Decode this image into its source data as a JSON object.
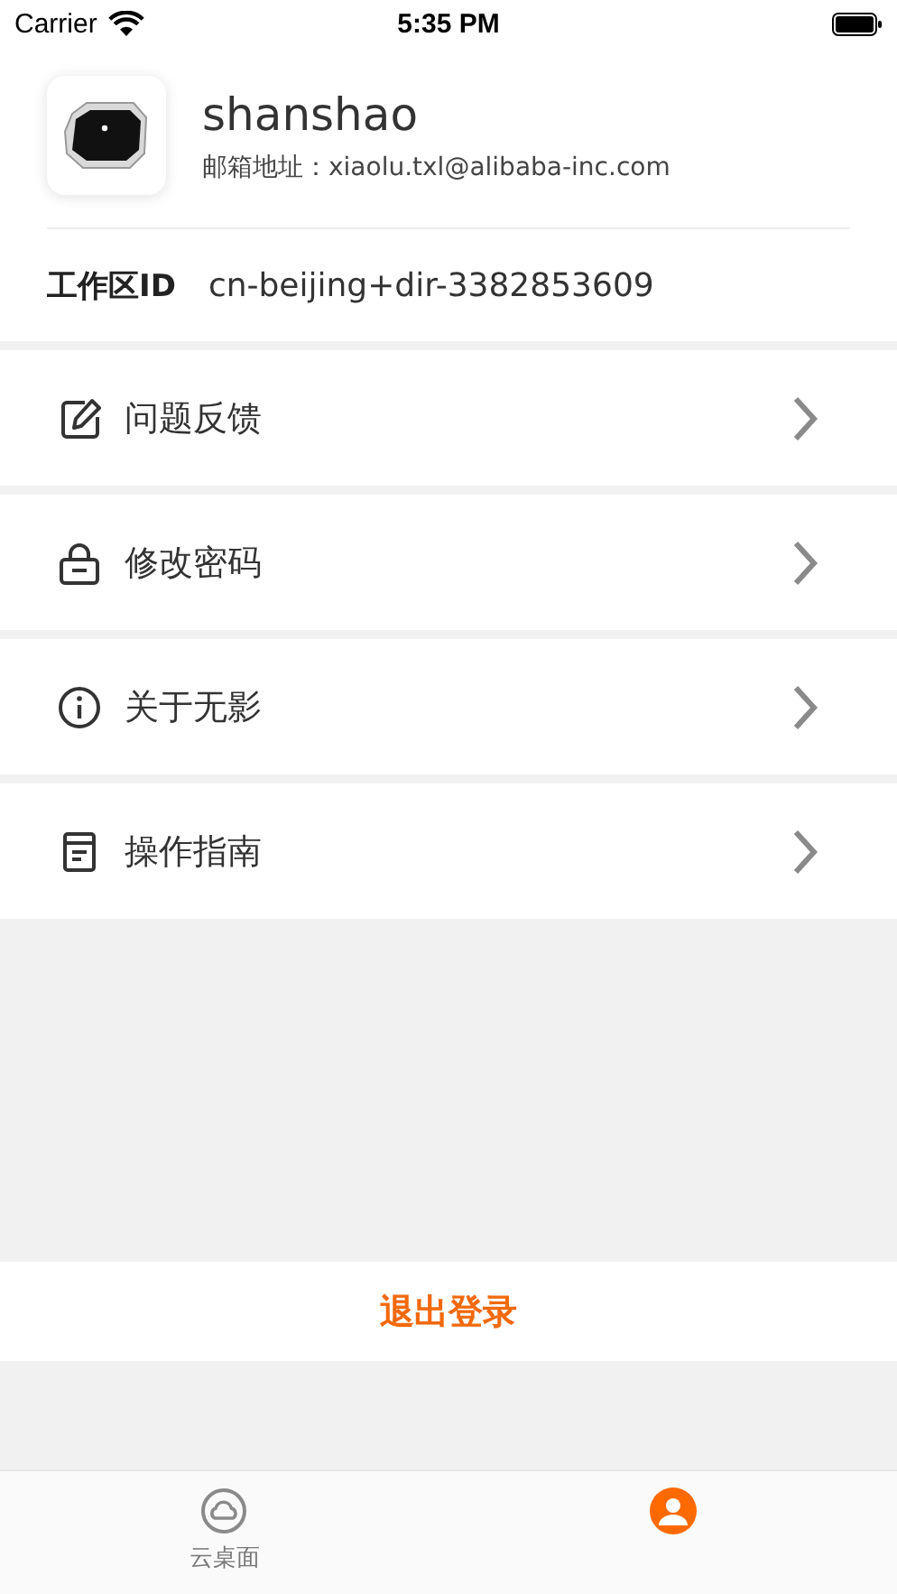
{
  "status_bar": {
    "carrier": "Carrier",
    "time": "5:35 PM"
  },
  "profile": {
    "name": "shanshao",
    "email": "邮箱地址：xiaolu.txl@alibaba-inc.com"
  },
  "workspace": {
    "label": "工作区ID",
    "value": "cn-beijing+dir-3382853609"
  },
  "menu": [
    {
      "kind": "edit",
      "label": "问题反馈"
    },
    {
      "kind": "lock",
      "label": "修改密码"
    },
    {
      "kind": "info",
      "label": "关于无影"
    },
    {
      "kind": "guide",
      "label": "操作指南"
    }
  ],
  "logout": "退出登录",
  "tabs": [
    {
      "kind": "cloud",
      "label": "云桌面",
      "selected": false
    },
    {
      "kind": "user",
      "selected": true
    }
  ]
}
